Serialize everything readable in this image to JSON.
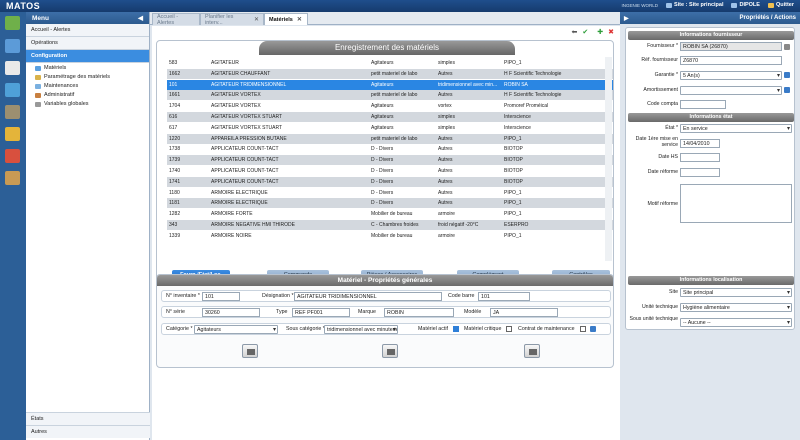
{
  "app": {
    "title": "MATOS",
    "site_label": "Site : Site principal",
    "user": "DIPOLE",
    "quit": "Quitter",
    "logo_text": "INGENIE WORLD"
  },
  "menu": {
    "title": "Menu",
    "sections": [
      "Accueil - Alertes",
      "Opérations",
      "Configuration"
    ],
    "items": [
      "Matériels",
      "Paramétrage des matériels",
      "Maintenances",
      "Administratif",
      "Variables globales"
    ],
    "bottom": [
      "États",
      "Autres"
    ]
  },
  "tabs": [
    "Accueil - Alertes",
    "Planifier les interv...",
    "Matériels"
  ],
  "grid": {
    "title": "Enregistrement des matériels",
    "rows": [
      [
        "583",
        "AGITATEUR",
        "Agitateurs",
        "simples",
        "PIPO_1"
      ],
      [
        "1662",
        "AGITATEUR CHAUFFANT",
        "petit materiel de labo",
        "Autres",
        "H F Scientific Technologie"
      ],
      [
        "101",
        "AGITATEUR TRIDIMENSIONNEL",
        "Agitateurs",
        "tridimensionnel avec min...",
        "ROBIN SA"
      ],
      [
        "1661",
        "AGITATEUR VORTEX",
        "petit materiel de labo",
        "Autres",
        "H F Scientific Technologie"
      ],
      [
        "1704",
        "AGITATEUR VORTEX",
        "Agitateurs",
        "vortex",
        "Promoref Proméical"
      ],
      [
        "616",
        "AGITATEUR VORTEX STUART",
        "Agitateurs",
        "simples",
        "Interscience"
      ],
      [
        "617",
        "AGITATEUR VORTEX STUART",
        "Agitateurs",
        "simples",
        "Interscience"
      ],
      [
        "1220",
        "APPAREILA PRESSION BUTANE",
        "petit materiel de labo",
        "Autres",
        "PIPO_1"
      ],
      [
        "1738",
        "APPLICATEUR COUNT-TACT",
        "D - Divers",
        "Autres",
        "BIOTOP"
      ],
      [
        "1739",
        "APPLICATEUR COUNT-TACT",
        "D - Divers",
        "Autres",
        "BIOTOP"
      ],
      [
        "1740",
        "APPLICATEUR COUNT-TACT",
        "D - Divers",
        "Autres",
        "BIOTOP"
      ],
      [
        "1741",
        "APPLICATEUR COUNT-TACT",
        "D - Divers",
        "Autres",
        "BIOTOP"
      ],
      [
        "1180",
        "ARMOIRE ELECTRIQUE",
        "D - Divers",
        "Autres",
        "PIPO_1"
      ],
      [
        "1181",
        "ARMOIRE ELECTRIQUE",
        "D - Divers",
        "Autres",
        "PIPO_1"
      ],
      [
        "1282",
        "ARMOIRE FORTE",
        "Mobilier de bureau",
        "armoire",
        "PIPO_1"
      ],
      [
        "343",
        "ARMOIRE NEGATIVE HMI THIRODE",
        "C - Chambres froides",
        "froid négatif -20°C",
        "ESERPRO"
      ],
      [
        "1339",
        "ARMOIRE NOIRE",
        "Mobilier de bureau",
        "armoire",
        "PIPO_1"
      ]
    ],
    "buttons": [
      "Fourn./Etat/Loc.",
      "Commande",
      "Pièces / Accessoires",
      "Complément",
      "Contrôles"
    ]
  },
  "props": {
    "title": "Matériel - Propriétés générales",
    "inventaire_label": "N° inventaire *",
    "inventaire": "101",
    "designation_label": "Désignation *",
    "designation": "AGITATEUR TRIDIMENSIONNEL",
    "codebarre_label": "Code barre",
    "codebarre": "101",
    "serie_label": "N° série",
    "serie": "30260",
    "type_label": "Type",
    "type": "REF PF001",
    "marque_label": "Marque",
    "marque": "ROBIN",
    "modele_label": "Modèle",
    "modele": "JA",
    "categorie_label": "Catégorie *",
    "categorie": "Agitateurs",
    "souscat_label": "Sous catégorie *",
    "souscat": "tridimensionnel avec minuterie",
    "actif_label": "Matériel actif",
    "critique_label": "Matériel critique",
    "contrat_label": "Contrat de maintenance"
  },
  "right": {
    "title": "Propriétés / Actions",
    "sec1": "Informations fournisseur",
    "fournisseur_label": "Fournisseur *",
    "fournisseur": "ROBIN SA (26870)",
    "ref_label": "Réf. fournisseur",
    "ref": "Z6870",
    "garantie_label": "Garantie *",
    "garantie": "5 An(s)",
    "amort_label": "Amortissement",
    "compta_label": "Code compta",
    "sec2": "Informations état",
    "etat_label": "État *",
    "etat": "En service",
    "date_label": "Date 1ère mise en service",
    "date": "14/04/2010",
    "hs_label": "Date HS",
    "reforme_label": "Date réforme",
    "motif_label": "Motif réforme",
    "sec3": "Informations localisation",
    "site_label": "Site",
    "site": "Site principal",
    "unite_label": "Unité technique",
    "unite": "Hygiène alimentaire",
    "sousunite_label": "Sous unité technique",
    "sousunite": "-- Aucune --"
  }
}
